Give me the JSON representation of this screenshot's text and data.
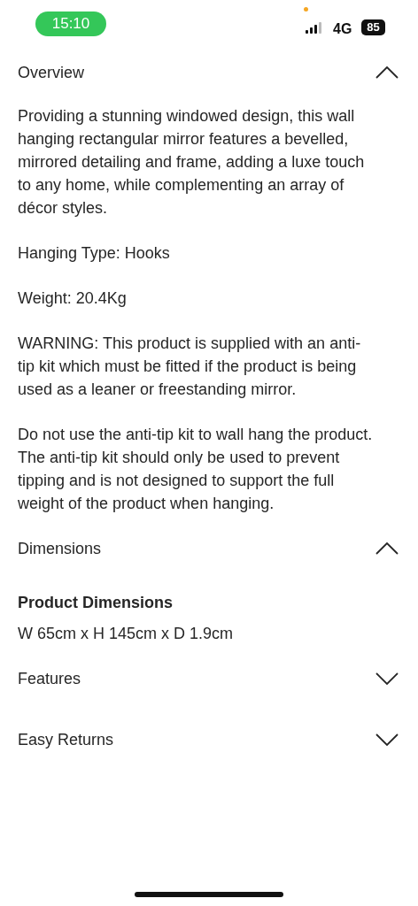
{
  "status_bar": {
    "time": "15:10",
    "network": "4G",
    "battery": "85"
  },
  "sections": [
    {
      "title": "Overview",
      "expanded": true,
      "content": [
        {
          "kind": "paragraph",
          "text": "Providing a stunning windowed design, this wall hanging rectangular mirror features a bevelled, mirrored detailing and frame, adding a luxe touch to any home, while complementing an array of décor styles."
        },
        {
          "kind": "paragraph",
          "text": "Hanging Type: Hooks"
        },
        {
          "kind": "paragraph",
          "text": "Weight: 20.4Kg"
        },
        {
          "kind": "paragraph",
          "text": "WARNING: This product is supplied with an anti-tip kit which must be fitted if the product is being used as a leaner or freestanding mirror."
        },
        {
          "kind": "paragraph",
          "text": "Do not use the anti-tip kit to wall hang the product. The anti-tip kit should only be used to prevent tipping and is not designed to support the full weight of the product when hanging."
        }
      ]
    },
    {
      "title": "Dimensions",
      "expanded": true,
      "content": [
        {
          "kind": "heading",
          "text": "Product Dimensions"
        },
        {
          "kind": "value",
          "text": "W 65cm x H 145cm x D 1.9cm"
        }
      ]
    },
    {
      "title": "Features",
      "expanded": false
    },
    {
      "title": "Easy Returns",
      "expanded": false
    }
  ]
}
